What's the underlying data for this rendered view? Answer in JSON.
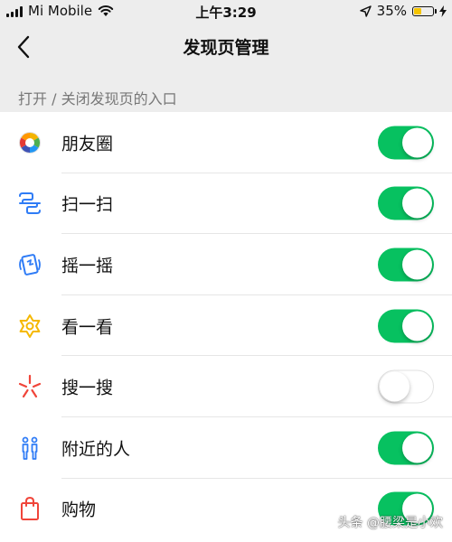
{
  "status_bar": {
    "carrier": "Mi Mobile",
    "time": "上午3:29",
    "battery_percent": "35%",
    "battery_level": 0.35,
    "battery_color": "#f5c400",
    "icons": [
      "signal-icon",
      "wifi-icon",
      "location-arrow-icon",
      "battery-icon",
      "charging-icon"
    ]
  },
  "nav": {
    "back_icon": "chevron-left-icon",
    "title": "发现页管理"
  },
  "section": {
    "header": "打开 / 关闭发现页的入口"
  },
  "accent_color": "#07c160",
  "items": [
    {
      "label": "朋友圈",
      "icon": "moments-icon",
      "enabled": true
    },
    {
      "label": "扫一扫",
      "icon": "scan-icon",
      "enabled": true
    },
    {
      "label": "摇一摇",
      "icon": "shake-icon",
      "enabled": true
    },
    {
      "label": "看一看",
      "icon": "top-stories-icon",
      "enabled": true
    },
    {
      "label": "搜一搜",
      "icon": "search-star-icon",
      "enabled": false
    },
    {
      "label": "附近的人",
      "icon": "people-nearby-icon",
      "enabled": true
    },
    {
      "label": "购物",
      "icon": "shopping-bag-icon",
      "enabled": true
    }
  ],
  "watermark": "头条 @腰梁是小欢"
}
